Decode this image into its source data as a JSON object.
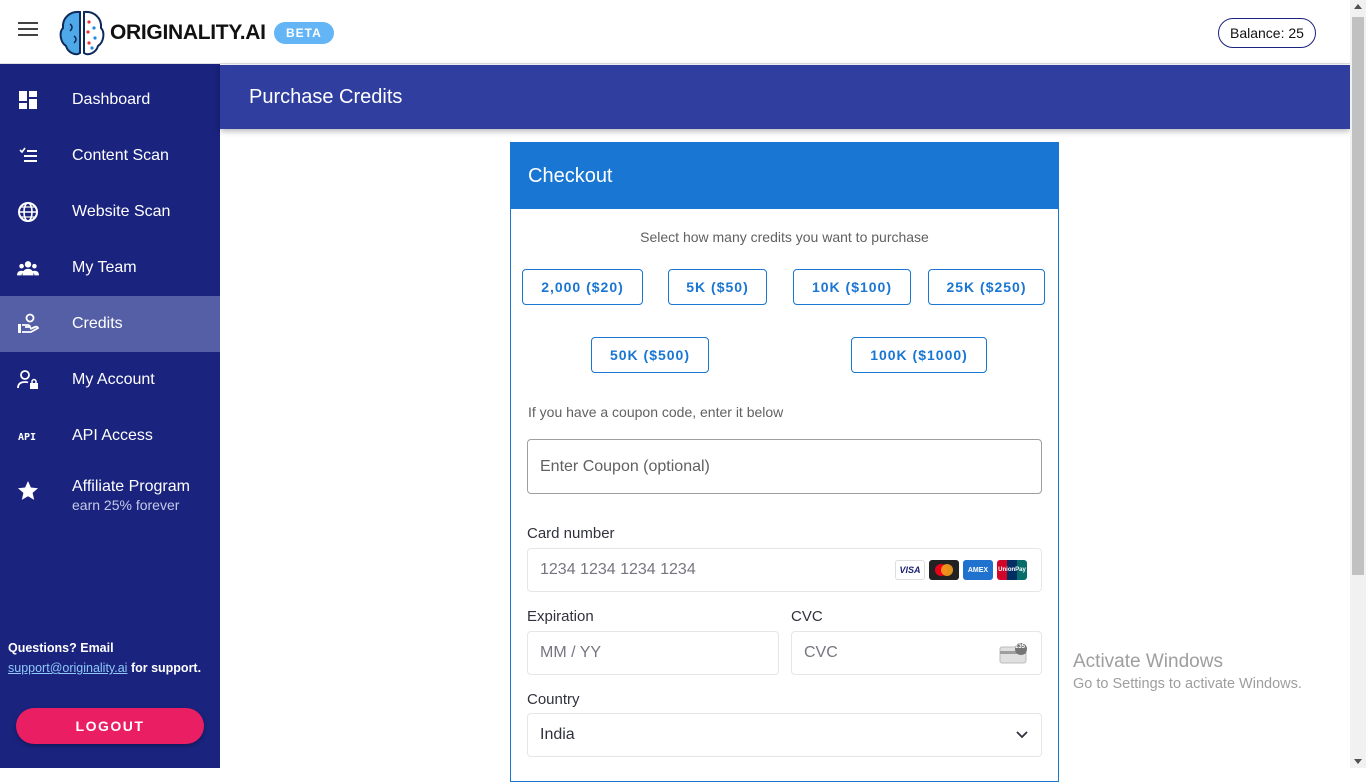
{
  "header": {
    "brand": "ORIGINALITY.AI",
    "badge": "BETA",
    "balance": "Balance: 25"
  },
  "sidebar": {
    "items": [
      {
        "label": "Dashboard",
        "icon": "dashboard-icon"
      },
      {
        "label": "Content Scan",
        "icon": "checklist-icon"
      },
      {
        "label": "Website Scan",
        "icon": "globe-icon"
      },
      {
        "label": "My Team",
        "icon": "group-icon"
      },
      {
        "label": "Credits",
        "icon": "credits-hand-icon",
        "active": true
      },
      {
        "label": "My Account",
        "icon": "user-lock-icon"
      },
      {
        "label": "API Access",
        "icon": "api-icon"
      },
      {
        "label": "Affiliate Program",
        "sub": "earn 25% forever",
        "icon": "star-icon"
      }
    ],
    "support_prefix": "Questions? Email",
    "support_email": "support@originality.ai",
    "support_suffix": " for support.",
    "logout": "LOGOUT"
  },
  "page": {
    "title": "Purchase Credits"
  },
  "checkout": {
    "title": "Checkout",
    "select_text": "Select how many credits you want to purchase",
    "options": [
      "2,000 ($20)",
      "5K ($50)",
      "10K ($100)",
      "25K ($250)",
      "50K ($500)",
      "100K ($1000)"
    ],
    "coupon_text": "If you have a coupon code, enter it below",
    "coupon_placeholder": "Enter Coupon (optional)",
    "card_label": "Card number",
    "card_placeholder": "1234 1234 1234 1234",
    "card_brands": [
      "VISA",
      "",
      "AMEX",
      "UnionPay"
    ],
    "expiration_label": "Expiration",
    "expiration_placeholder": "MM / YY",
    "cvc_label": "CVC",
    "cvc_placeholder": "CVC",
    "cvc_icon_text": "135",
    "country_label": "Country",
    "country_value": "India"
  },
  "watermark": {
    "title": "Activate Windows",
    "subtitle": "Go to Settings to activate Windows."
  },
  "colors": {
    "sidebar": "#1a237e",
    "active_item": "#555fa6",
    "page_bar": "#303f9f",
    "checkout_header": "#1976d2",
    "logout": "#e91e63",
    "beta": "#64b5f6"
  }
}
